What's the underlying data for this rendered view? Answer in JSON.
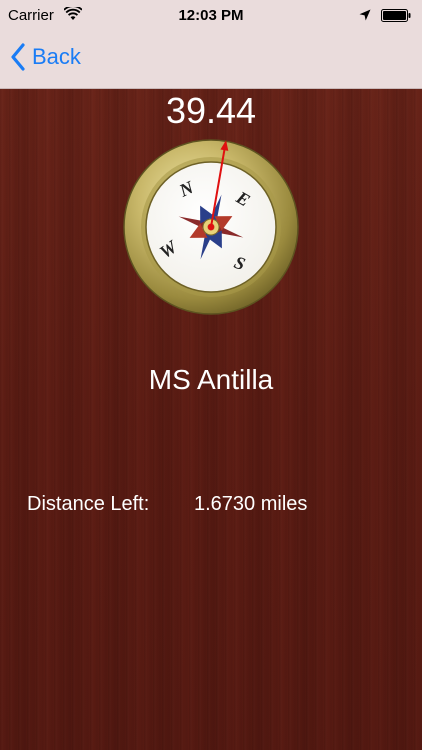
{
  "status_bar": {
    "carrier": "Carrier",
    "time": "12:03 PM",
    "wifi_icon": "wifi-icon",
    "location_icon": "location-arrow-icon",
    "battery_icon": "battery-icon"
  },
  "nav": {
    "back_label": "Back",
    "back_icon": "chevron-left-icon",
    "accent_color": "#1a7cf5"
  },
  "compass": {
    "heading": "39.44",
    "heading_degrees": 39.44,
    "labels": {
      "north": "N",
      "east": "E",
      "south": "S",
      "west": "W"
    }
  },
  "target": {
    "name": "MS Antilla",
    "distance_label": "Distance Left:",
    "distance_value": "1.6730 miles"
  },
  "colors": {
    "background_wood": "#5f1f17",
    "nav_background": "#eadcdc",
    "text": "#ffffff",
    "needle": "#e01010"
  }
}
